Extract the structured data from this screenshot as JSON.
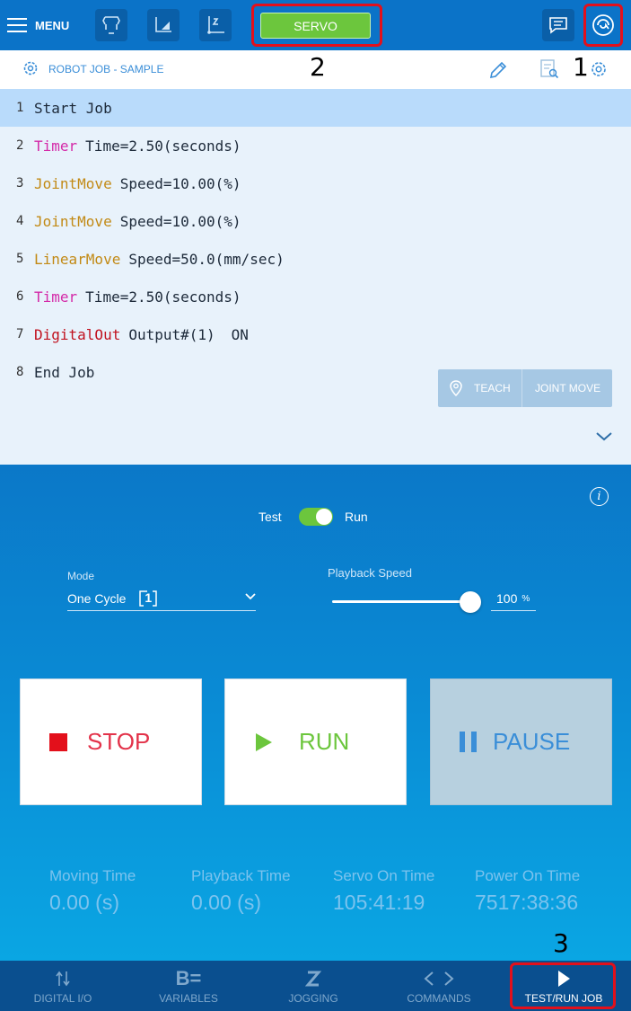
{
  "topbar": {
    "menu_label": "MENU",
    "tool_icons": [
      "gripper-icon",
      "coordinate-frame-icon",
      "tool-frame-icon"
    ],
    "servo_label": "SERVO",
    "chat_icon": "chat-icon",
    "connection_icon": "connection-icon"
  },
  "annotations": {
    "a1": "1",
    "a2": "2",
    "a3": "3"
  },
  "job_header": {
    "title": "ROBOT JOB - SAMPLE"
  },
  "code": {
    "lines": [
      {
        "num": "1",
        "text": "Start Job"
      },
      {
        "num": "2",
        "cmd": "Timer",
        "param": "Time=2.50(seconds)"
      },
      {
        "num": "3",
        "cmd": "JointMove",
        "param": "Speed=10.00(%)"
      },
      {
        "num": "4",
        "cmd": "JointMove",
        "param": "Speed=10.00(%)"
      },
      {
        "num": "5",
        "cmd": "LinearMove",
        "param": "Speed=50.0(mm/sec)"
      },
      {
        "num": "6",
        "cmd": "Timer",
        "param": "Time=2.50(seconds)"
      },
      {
        "num": "7",
        "cmd": "DigitalOut",
        "param": "Output#(1)",
        "param2": "ON"
      },
      {
        "num": "8",
        "text": "End Job"
      }
    ],
    "teach_label": "TEACH",
    "joint_move_label": "JOINT MOVE"
  },
  "control": {
    "info_label": "i",
    "test_label": "Test",
    "run_label": "Run",
    "mode_label": "Mode",
    "mode_value": "One Cycle",
    "mode_icon_digit": "1",
    "speed_label": "Playback Speed",
    "speed_value": "100",
    "speed_unit": "%",
    "speed_level": 100,
    "stop_label": "STOP",
    "run_button_label": "RUN",
    "pause_label": "PAUSE",
    "stats": [
      {
        "label": "Moving Time",
        "value": "0.00 (s)"
      },
      {
        "label": "Playback Time",
        "value": "0.00 (s)"
      },
      {
        "label": "Servo On Time",
        "value": "105:41:19"
      },
      {
        "label": "Power On Time",
        "value": "7517:38:36"
      }
    ]
  },
  "bottomnav": {
    "items": [
      {
        "label": "DIGITAL I/O",
        "icon": "digital-io-icon"
      },
      {
        "label": "VARIABLES",
        "icon": "variables-icon"
      },
      {
        "label": "JOGGING",
        "icon": "jogging-icon"
      },
      {
        "label": "COMMANDS",
        "icon": "commands-icon"
      },
      {
        "label": "TEST/RUN JOB",
        "icon": "play-icon"
      }
    ]
  },
  "colors": {
    "topbar": "#0b73c8",
    "servo_green": "#6cc63d",
    "annotation_red": "#e3101b",
    "stop_red": "#e3334a",
    "run_green": "#6cc63d",
    "pause_blue": "#3a8ed8"
  }
}
